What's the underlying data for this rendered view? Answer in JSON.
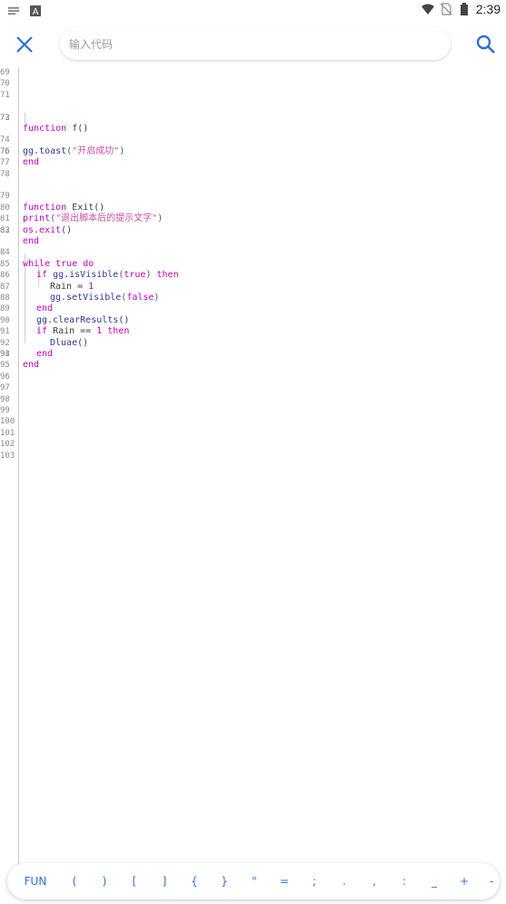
{
  "status_bar": {
    "time": "2:39",
    "icons": [
      "notification-icon",
      "a-icon",
      "wifi-icon",
      "no-sim-icon",
      "battery-icon"
    ]
  },
  "search": {
    "placeholder": "输入代码",
    "value": ""
  },
  "colors": {
    "accent": "#2f6fd6",
    "keyword": "#c000c0",
    "string": "#c8509a",
    "function": "#2d3a8c"
  },
  "editor": {
    "line_numbers": [
      "69",
      "70",
      "71",
      "72",
      "73",
      "74",
      "75",
      "76",
      "77",
      "78",
      "79",
      "80",
      "81",
      "82",
      "83",
      "84",
      "85",
      "86",
      "87",
      "88",
      "89",
      "90",
      "91",
      "92",
      "93",
      "94",
      "95",
      "96",
      "97",
      "98",
      "99",
      "100",
      "101",
      "102",
      "103"
    ],
    "code": {
      "l72_kw": "function",
      "l72_rest": " f()",
      "l74_fn": "gg.toast",
      "l74_open": "(",
      "l74_str": "\"开启成功\"",
      "l74_close": ")",
      "l75_kw": "end",
      "l79_kw": "function",
      "l79_rest": " Exit()",
      "l80_fn": "print",
      "l80_open": "(",
      "l80_str": "\"退出脚本后的提示文字\"",
      "l80_close": ")",
      "l81_fn": "os.exit",
      "l81_rest": "()",
      "l82_kw": "end",
      "l84_kw1": "while",
      "l84_kw2": " true",
      "l84_kw3": " do",
      "l85_kw": "if",
      "l85_fn": " gg.isVisible",
      "l85_open": "(",
      "l85_arg": "true",
      "l85_close": ")",
      "l85_then": " then",
      "l86_var": "Rain = ",
      "l86_num": "1",
      "l87_fn": "gg.setVisible",
      "l87_open": "(",
      "l87_arg": "false",
      "l87_close": ")",
      "l88_kw": "end",
      "l89_fn": "gg.clearResults",
      "l89_rest": "()",
      "l90_kw": "if",
      "l90_var": " Rain == ",
      "l90_num": "1",
      "l90_then": " then",
      "l91_fn": "Dluae",
      "l91_rest": "()",
      "l92_kw": "end",
      "l93_kw": "end"
    }
  },
  "symbol_bar": [
    "FUN",
    "(",
    ")",
    "[",
    "]",
    "{",
    "}",
    "\"",
    "=",
    ";",
    ".",
    ",",
    ":",
    "_",
    "+",
    "-"
  ]
}
